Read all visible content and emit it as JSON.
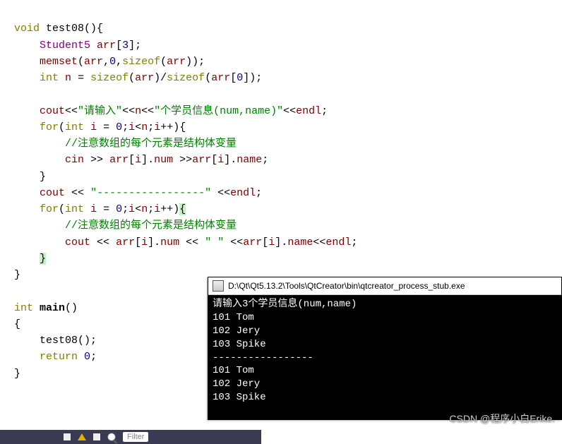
{
  "code": {
    "l1_void": "void",
    "l1_fn": "test08",
    "l2_ty": "Student5",
    "l2_arr": "arr",
    "l2_size": "3",
    "l3_memset": "memset",
    "l3_arr1": "arr",
    "l3_zero": "0",
    "l3_sizeof": "sizeof",
    "l3_arr2": "arr",
    "l4_int": "int",
    "l4_n": "n",
    "l4_sz1": "sizeof",
    "l4_arr1": "arr",
    "l4_sz2": "sizeof",
    "l4_arr2": "arr",
    "l4_idx": "0",
    "l6_cout": "cout",
    "l6_s1": "\"请输入\"",
    "l6_n": "n",
    "l6_s2": "\"个学员信息(num,name)\"",
    "l6_endl": "endl",
    "l7_for": "for",
    "l7_int": "int",
    "l7_i1": "i",
    "l7_z": "0",
    "l7_i2": "i",
    "l7_n": "n",
    "l7_i3": "i",
    "l8_comment": "//注意数组的每个元素是结构体变量",
    "l9_cin": "cin",
    "l9_arr1": "arr",
    "l9_i1": "i",
    "l9_num": "num",
    "l9_arr2": "arr",
    "l9_i2": "i",
    "l9_name": "name",
    "l11_cout": "cout",
    "l11_s": "\"-----------------\"",
    "l11_endl": "endl",
    "l12_for": "for",
    "l12_int": "int",
    "l12_i1": "i",
    "l12_z": "0",
    "l12_i2": "i",
    "l12_n": "n",
    "l12_i3": "i",
    "l13_comment": "//注意数组的每个元素是结构体变量",
    "l14_cout": "cout",
    "l14_arr1": "arr",
    "l14_i1": "i",
    "l14_num": "num",
    "l14_s": "\" \"",
    "l14_arr2": "arr",
    "l14_i2": "i",
    "l14_name": "name",
    "l14_endl": "endl",
    "l18_int": "int",
    "l18_main": "main",
    "l20_call": "test08",
    "l21_ret": "return",
    "l21_z": "0"
  },
  "console": {
    "title": "D:\\Qt\\Qt5.13.2\\Tools\\QtCreator\\bin\\qtcreator_process_stub.exe",
    "lines": [
      "请输入3个学员信息(num,name)",
      "101 Tom",
      "102 Jery",
      "103 Spike",
      "-----------------",
      "101 Tom",
      "102 Jery",
      "103 Spike"
    ]
  },
  "watermark": "CSDN @程序小白Erike.",
  "bottombar": {
    "filter": "Filter"
  }
}
